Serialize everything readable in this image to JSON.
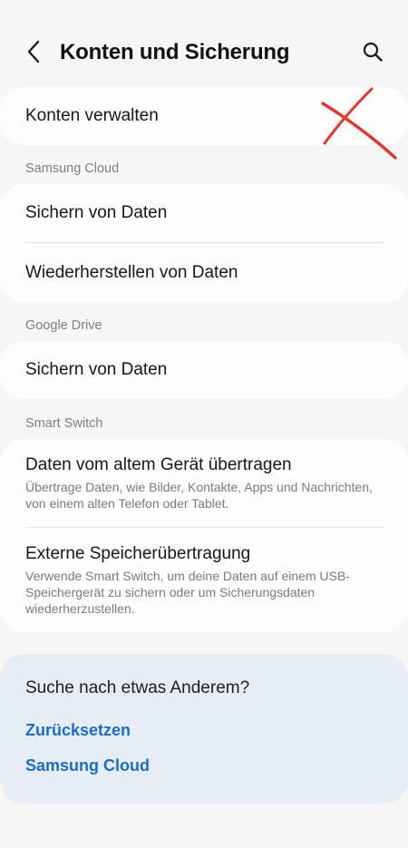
{
  "header": {
    "title": "Konten und Sicherung",
    "back_icon": "back-chevron-icon",
    "search_icon": "search-icon"
  },
  "accounts": {
    "manage_label": "Konten verwalten"
  },
  "samsung_cloud": {
    "section_label": "Samsung Cloud",
    "backup_label": "Sichern von Daten",
    "restore_label": "Wiederherstellen von Daten"
  },
  "google_drive": {
    "section_label": "Google Drive",
    "backup_label": "Sichern von Daten"
  },
  "smart_switch": {
    "section_label": "Smart Switch",
    "transfer_title": "Daten vom altem Gerät übertragen",
    "transfer_sub": "Übertrage Daten, wie Bilder, Kontakte, Apps und Nachrichten, von einem alten Telefon oder Tablet.",
    "external_title": "Externe Speicherübertragung",
    "external_sub": "Verwende Smart Switch, um deine Daten auf einem USB-Speichergerät zu sichern oder um Sicherungsdaten wiederherzustellen."
  },
  "suggestions": {
    "title": "Suche nach etwas Anderem?",
    "links": [
      "Zurücksetzen",
      "Samsung Cloud"
    ]
  },
  "colors": {
    "background": "#f6f6f6",
    "card": "#fdfdfd",
    "suggest_bg": "#e6edf4",
    "link": "#1a6ec9",
    "annotation_red": "#e8322c"
  }
}
